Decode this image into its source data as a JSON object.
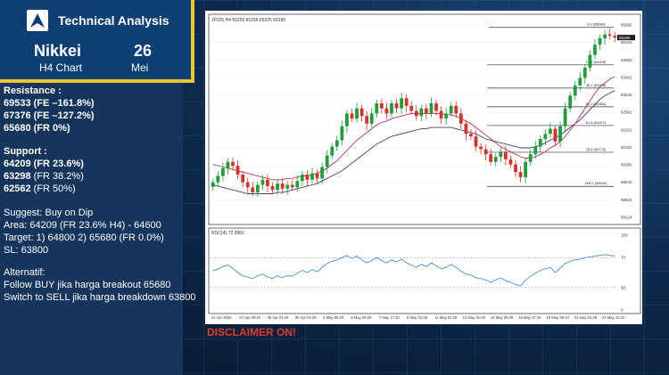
{
  "header": {
    "brand": "Technical Analysis",
    "market": "Nikkei",
    "timeframe": "H4 Chart",
    "day": "26",
    "month": "Mei"
  },
  "colors": {
    "bull": "#1f9d3a",
    "bear": "#d6322c",
    "accent": "#f0c431",
    "disclaimer": "#e03a2e"
  },
  "resistance": {
    "title": "Resistance :",
    "levels": [
      "69533 (FE –161.8%)",
      "67376 (FE –127.2%)",
      "65680 (FR 0%)"
    ]
  },
  "support": {
    "title": "Support :",
    "levels": [
      {
        "price": "64209",
        "note": " (FR 23.6%)"
      },
      {
        "price": "63298",
        "note": " (FR 38.2%)"
      },
      {
        "price": "62562",
        "note": " (FR 50%)"
      }
    ]
  },
  "suggest": {
    "line1": "Suggest: Buy on Dip",
    "line2": "Area: 64209 (FR 23.6% H4) - 64600",
    "line3": "Target: 1) 64800 2) 65680 (FR 0.0%)",
    "line4": "SL: 63800"
  },
  "alternatif": {
    "title": "Alternatif:",
    "line1": "Follow BUY jika harga breakout 65680",
    "line2": "Switch to SELL jika harga breakdown 63800"
  },
  "disclaimer": "DISCLAIMER ON!",
  "chart_data": [
    {
      "type": "candlestick",
      "title": "JP225,H4  65255 65295 65225 65280",
      "price_label": "65280",
      "ylim": [
        58224,
        65775
      ],
      "y_ticks": [
        "65682",
        "65104",
        "64662",
        "63962",
        "63242",
        "62562",
        "61822",
        "61102",
        "60382",
        "59642",
        "58942",
        "58224"
      ],
      "x_ticks": [
        "21 Apr 2026",
        "27 Apr 09:10",
        "28 Apr 01:29",
        "30 Apr 01:29",
        "4 May 05:29",
        "5 May 05:29",
        "7 May 17:10",
        "8 May 01:29",
        "11 May 01:29",
        "12 May 01:29",
        "14 May 05:29",
        "15 May 17:10",
        "19 May 09:10",
        "21 May 01:29",
        "22 May 13:10"
      ],
      "fib_levels": [
        {
          "label": "0.0 (65680)",
          "price": 65680
        },
        {
          "label": "23.6 (64209)",
          "price": 64209
        },
        {
          "label": "38.2 (63298)",
          "price": 63298
        },
        {
          "label": "50.0 (62562)",
          "price": 62562
        },
        {
          "label": "61.8 (61827)",
          "price": 61827
        },
        {
          "label": "78.6 (60779)",
          "price": 60779
        },
        {
          "label": "100.0 (59440)",
          "price": 59440
        }
      ],
      "close": [
        59600,
        59850,
        60150,
        60400,
        60250,
        59900,
        59600,
        59400,
        59200,
        59500,
        59700,
        59450,
        59300,
        59550,
        59350,
        59500,
        59400,
        59650,
        59900,
        59700,
        59950,
        59750,
        60200,
        60650,
        61000,
        61250,
        61800,
        62300,
        62100,
        62500,
        62200,
        61900,
        62300,
        62700,
        62500,
        62300,
        62700,
        62500,
        62900,
        62600,
        62400,
        62200,
        62500,
        62300,
        62700,
        62400,
        62100,
        62300,
        62600,
        62300,
        61900,
        61500,
        61400,
        61000,
        60900,
        60700,
        60400,
        60600,
        60800,
        60500,
        60300,
        60000,
        59800,
        60400,
        60700,
        61000,
        61300,
        61500,
        61700,
        61200,
        61800,
        62500,
        63000,
        63400,
        63700,
        64100,
        64600,
        65000,
        65250,
        65400,
        65350,
        65280
      ],
      "ma_fast": [
        60300,
        60250,
        60200,
        60150,
        60100,
        60050,
        60000,
        59950,
        59900,
        59850,
        59800,
        59750,
        59700,
        59700,
        59700,
        59750,
        59750,
        59800,
        59850,
        59850,
        59900,
        59950,
        60050,
        60150,
        60300,
        60450,
        60650,
        60850,
        61050,
        61250,
        61400,
        61550,
        61700,
        61850,
        61950,
        62000,
        62100,
        62150,
        62200,
        62250,
        62300,
        62300,
        62300,
        62300,
        62300,
        62300,
        62300,
        62250,
        62250,
        62200,
        62100,
        62000,
        61900,
        61750,
        61600,
        61450,
        61300,
        61150,
        61000,
        60900,
        60800,
        60700,
        60600,
        60550,
        60550,
        60600,
        60700,
        60800,
        60950,
        61050,
        61200,
        61400,
        61650,
        61900,
        62200,
        62500,
        62800,
        63100,
        63350,
        63500,
        63650,
        63750
      ],
      "ma_slow": [
        59500,
        59450,
        59400,
        59350,
        59300,
        59250,
        59200,
        59150,
        59150,
        59150,
        59150,
        59150,
        59150,
        59200,
        59200,
        59250,
        59300,
        59350,
        59400,
        59450,
        59500,
        59550,
        59650,
        59750,
        59850,
        59950,
        60050,
        60200,
        60350,
        60500,
        60650,
        60800,
        60950,
        61100,
        61200,
        61300,
        61400,
        61450,
        61500,
        61550,
        61600,
        61650,
        61700,
        61700,
        61750,
        61750,
        61750,
        61750,
        61750,
        61700,
        61650,
        61600,
        61550,
        61500,
        61400,
        61300,
        61250,
        61200,
        61150,
        61100,
        61050,
        61000,
        60950,
        60950,
        60950,
        61000,
        61050,
        61150,
        61250,
        61350,
        61450,
        61600,
        61750,
        61900,
        62050,
        62250,
        62450,
        62650,
        62850,
        63000,
        63100,
        63200
      ]
    },
    {
      "type": "line",
      "title": "RSI(14) 72.3860",
      "ylim": [
        0,
        100
      ],
      "y_ticks": [
        {
          "label": "100",
          "value": 100
        },
        {
          "label": "70",
          "value": 70
        },
        {
          "label": "30",
          "value": 30
        },
        {
          "label": "0",
          "value": 0
        }
      ],
      "levels": [
        70,
        30
      ],
      "values": [
        52,
        55,
        58,
        60,
        56,
        50,
        46,
        44,
        42,
        46,
        48,
        44,
        42,
        46,
        43,
        46,
        45,
        49,
        53,
        50,
        54,
        51,
        57,
        62,
        65,
        67,
        70,
        73,
        69,
        72,
        67,
        63,
        66,
        70,
        66,
        63,
        67,
        64,
        68,
        63,
        60,
        57,
        61,
        58,
        63,
        59,
        55,
        57,
        61,
        57,
        52,
        48,
        47,
        43,
        42,
        40,
        37,
        40,
        43,
        39,
        37,
        34,
        32,
        40,
        45,
        49,
        53,
        55,
        57,
        50,
        56,
        62,
        65,
        67,
        68,
        70,
        71,
        72,
        73,
        74,
        73,
        72
      ]
    }
  ]
}
